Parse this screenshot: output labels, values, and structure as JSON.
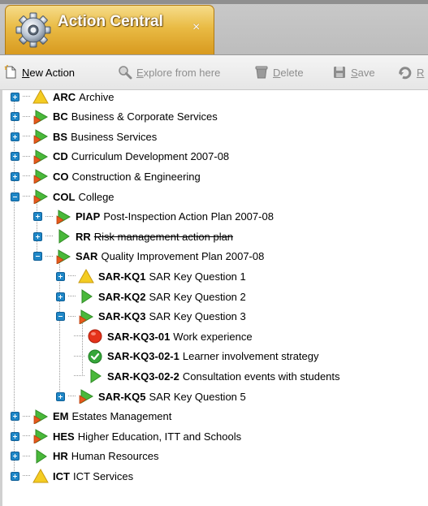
{
  "tab": {
    "title": "Action Central",
    "close": "×",
    "icon": "gear-icon"
  },
  "toolbar": {
    "buttons": [
      {
        "label": "New Action",
        "icon": "new-document-icon",
        "underline": "N",
        "rest": "ew Action",
        "enabled": true
      },
      {
        "label": "Explore from here",
        "icon": "magnifier-icon",
        "underline": "E",
        "rest": "xplore from here",
        "enabled": false
      },
      {
        "label": "Delete",
        "icon": "delete-icon",
        "underline": "D",
        "rest": "elete",
        "enabled": false
      },
      {
        "label": "Save",
        "icon": "save-icon",
        "underline": "S",
        "rest": "ave",
        "enabled": false
      },
      {
        "label": "R",
        "icon": "reload-icon",
        "underline": "R",
        "rest": "",
        "enabled": false
      }
    ]
  },
  "tree": [
    {
      "code": "ARC",
      "name": "Archive",
      "status": "warning",
      "expanded": false,
      "depth": 0
    },
    {
      "code": "BC",
      "name": "Business & Corporate Services",
      "status": "mixed",
      "expanded": false,
      "depth": 0
    },
    {
      "code": "BS",
      "name": "Business Services",
      "status": "mixed",
      "expanded": false,
      "depth": 0
    },
    {
      "code": "CD",
      "name": "Curriculum Development 2007-08",
      "status": "mixed",
      "expanded": false,
      "depth": 0
    },
    {
      "code": "CO",
      "name": "Construction & Engineering",
      "status": "mixed",
      "expanded": false,
      "depth": 0
    },
    {
      "code": "COL",
      "name": "College",
      "status": "mixed",
      "expanded": true,
      "depth": 0
    },
    {
      "code": "PIAP",
      "name": "Post-Inspection Action Plan 2007-08",
      "status": "mixed",
      "expanded": false,
      "depth": 1
    },
    {
      "code": "RR",
      "name": "Risk management action plan",
      "status": "green",
      "expanded": false,
      "depth": 1,
      "strike": true
    },
    {
      "code": "SAR",
      "name": "Quality Improvement Plan 2007-08",
      "status": "mixed",
      "expanded": true,
      "depth": 1
    },
    {
      "code": "SAR-KQ1",
      "name": "SAR Key Question 1",
      "status": "warning",
      "expanded": false,
      "depth": 2
    },
    {
      "code": "SAR-KQ2",
      "name": "SAR Key Question 2",
      "status": "green",
      "expanded": false,
      "depth": 2
    },
    {
      "code": "SAR-KQ3",
      "name": "SAR Key Question 3",
      "status": "mixed",
      "expanded": true,
      "depth": 2
    },
    {
      "code": "SAR-KQ3-01",
      "name": "Work experience",
      "status": "stop",
      "leaf": true,
      "depth": 3
    },
    {
      "code": "SAR-KQ3-02-1",
      "name": "Learner involvement strategy",
      "status": "done",
      "leaf": true,
      "depth": 3
    },
    {
      "code": "SAR-KQ3-02-2",
      "name": "Consultation events with students",
      "status": "green",
      "leaf": true,
      "depth": 3
    },
    {
      "code": "SAR-KQ5",
      "name": "SAR Key Question 5",
      "status": "mixed",
      "expanded": false,
      "depth": 2
    },
    {
      "code": "EM",
      "name": "Estates Management",
      "status": "mixed",
      "expanded": false,
      "depth": 0
    },
    {
      "code": "HES",
      "name": "Higher Education, ITT and Schools",
      "status": "mixed",
      "expanded": false,
      "depth": 0
    },
    {
      "code": "HR",
      "name": "Human Resources",
      "status": "green",
      "expanded": false,
      "depth": 0
    },
    {
      "code": "ICT",
      "name": "ICT Services",
      "status": "warning",
      "expanded": false,
      "depth": 0
    }
  ],
  "colors": {
    "accent": "#e3a62c",
    "toggle": "#1f87c7",
    "green": "#3db33a",
    "red": "#e23018",
    "yellow": "#f2c51e"
  }
}
